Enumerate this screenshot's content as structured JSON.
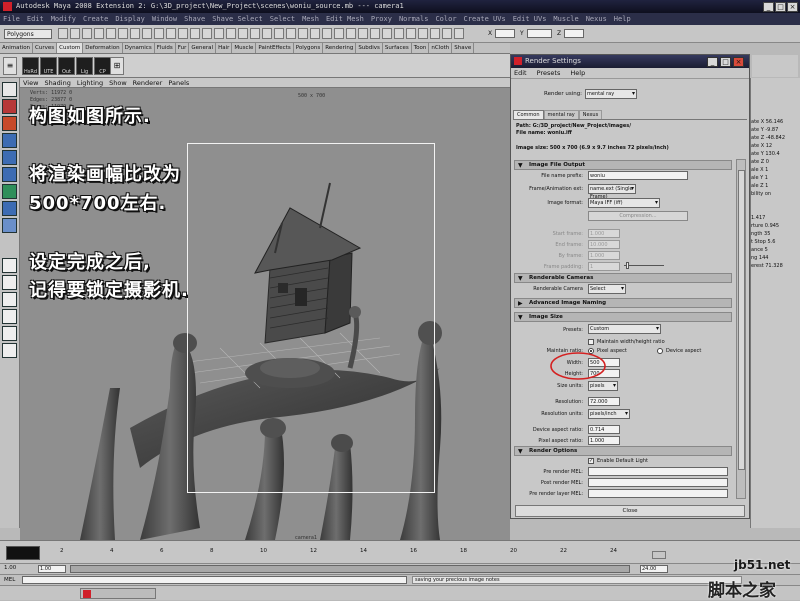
{
  "window": {
    "title": "Autodesk Maya 2008 Extension 2: G:\\3D_project\\New_Project\\scenes\\woniu_source.mb   ---   camera1",
    "menus": [
      "File",
      "Edit",
      "Modify",
      "Create",
      "Display",
      "Window",
      "Shave",
      "Shave Select",
      "Select",
      "Mesh",
      "Edit Mesh",
      "Proxy",
      "Normals",
      "Color",
      "Create UVs",
      "Edit UVs",
      "Muscle",
      "Nexus",
      "Help"
    ]
  },
  "statusline": {
    "mode": "Polygons",
    "field_x": "X",
    "field_y": "Y",
    "field_z": "Z"
  },
  "shelf": {
    "tabs": [
      "Animation",
      "Curves",
      "Custom",
      "Deformation",
      "Dynamics",
      "Fluids",
      "Fur",
      "General",
      "Hair",
      "Muscle",
      "PaintEffects",
      "Polygons",
      "Rendering",
      "Subdivs",
      "Surfaces",
      "Toon",
      "nCloth",
      "Shave"
    ],
    "active_tab": "Custom",
    "buttons": [
      "HsRd",
      "UTE",
      "Out",
      "Lig",
      "CP"
    ]
  },
  "viewport": {
    "panel_menus": [
      "View",
      "Shading",
      "Lighting",
      "Show",
      "Renderer",
      "Panels"
    ],
    "resolution_readout": "500 x 700",
    "hud_stats": [
      {
        "label": "Verts:",
        "value": "11972",
        "extra": "0"
      },
      {
        "label": "Edges:",
        "value": "23877",
        "extra": "0"
      },
      {
        "label": "Faces:",
        "value": "11979",
        "extra": "0"
      },
      {
        "label": "UVs:",
        "value": "32273",
        "extra": "0"
      }
    ],
    "camera_label": "camera1",
    "annotations": [
      "构图如图所示.",
      "将渲染画幅比改为",
      "500*700左右.",
      "设定完成之后,",
      "记得要锁定摄影机."
    ]
  },
  "render_settings": {
    "title": "Render Settings",
    "menus": [
      "Edit",
      "Presets",
      "Help"
    ],
    "render_using_label": "Render using:",
    "render_using": "mental ray",
    "tabs": [
      "Common",
      "mental ray",
      "Nexus"
    ],
    "active_tab": "Common",
    "path": "Path: G:/3D_project/New_Project/images/",
    "file_name": "File name: woniu.iff",
    "image_size_info": "Image size: 500 x 700 (6.9 x 9.7 inches 72 pixels/inch)",
    "sections": {
      "image_file_output": "Image File Output",
      "renderable_cameras": "Renderable Cameras",
      "advanced_naming": "Advanced Image Naming",
      "image_size": "Image Size",
      "render_options": "Render Options"
    },
    "file_name_prefix_label": "File name prefix:",
    "file_name_prefix": "woniu",
    "frame_anim_ext_label": "Frame/Animation ext:",
    "frame_anim_ext": "name.ext (Single Frame)",
    "image_format_label": "Image format:",
    "image_format": "Maya IFF (iff)",
    "compression_label": "Compression...",
    "start_frame_label": "Start frame:",
    "start_frame": "1.000",
    "end_frame_label": "End frame:",
    "end_frame": "10.000",
    "by_frame_label": "By frame:",
    "by_frame": "1.000",
    "frame_padding_label": "Frame padding:",
    "frame_padding": "1",
    "renderable_camera_label": "Renderable Camera",
    "renderable_camera": "Select",
    "presets_label": "Presets:",
    "presets": "Custom",
    "maintain_ratio_checkbox": "Maintain width/height ratio",
    "maintain_ratio_label": "Maintain ratio:",
    "ratio_options": [
      "Pixel aspect",
      "Device aspect"
    ],
    "width_label": "Width:",
    "width": "500",
    "height_label": "Height:",
    "height": "700",
    "size_units_label": "Size units:",
    "size_units": "pixels",
    "resolution_label": "Resolution:",
    "resolution": "72.000",
    "resolution_units_label": "Resolution units:",
    "resolution_units": "pixels/inch",
    "device_aspect_label": "Device aspect ratio:",
    "device_aspect": "0.714",
    "pixel_aspect_label": "Pixel aspect ratio:",
    "pixel_aspect": "1.000",
    "enable_default_light": "Enable Default Light",
    "pre_render_mel_label": "Pre render MEL:",
    "post_render_mel_label": "Post render MEL:",
    "pre_render_layer_mel_label": "Pre render layer MEL:",
    "close_label": "Close"
  },
  "attribute_panel": {
    "rows": [
      "ate X  56.146",
      "ate Y  -9.87",
      "ate Z  -48.842",
      "ate X  12",
      "ate Y  130.4",
      "ate Z  0",
      "ale X  1",
      "ale Y  1",
      "ale Z  1",
      "bility  on"
    ],
    "rows2": [
      "1.417",
      "rture  0.945",
      "ngth  35",
      "t Stop  5.6",
      "ance  5",
      "ng  144",
      "erest  71.328"
    ]
  },
  "timeline": {
    "ticks": [
      "2",
      "4",
      "6",
      "8",
      "10",
      "12",
      "14",
      "16",
      "18",
      "20",
      "22",
      "24"
    ],
    "start": "1.00",
    "start2": "1.00",
    "end": "24.00",
    "mel_label": "MEL",
    "status_message": "saving your precious image notes"
  },
  "watermark": {
    "site": "jb51.net",
    "name": "脚本之家"
  },
  "colors": {
    "highlight_circle": "#d42020",
    "title_bar": "#1c1e36"
  }
}
